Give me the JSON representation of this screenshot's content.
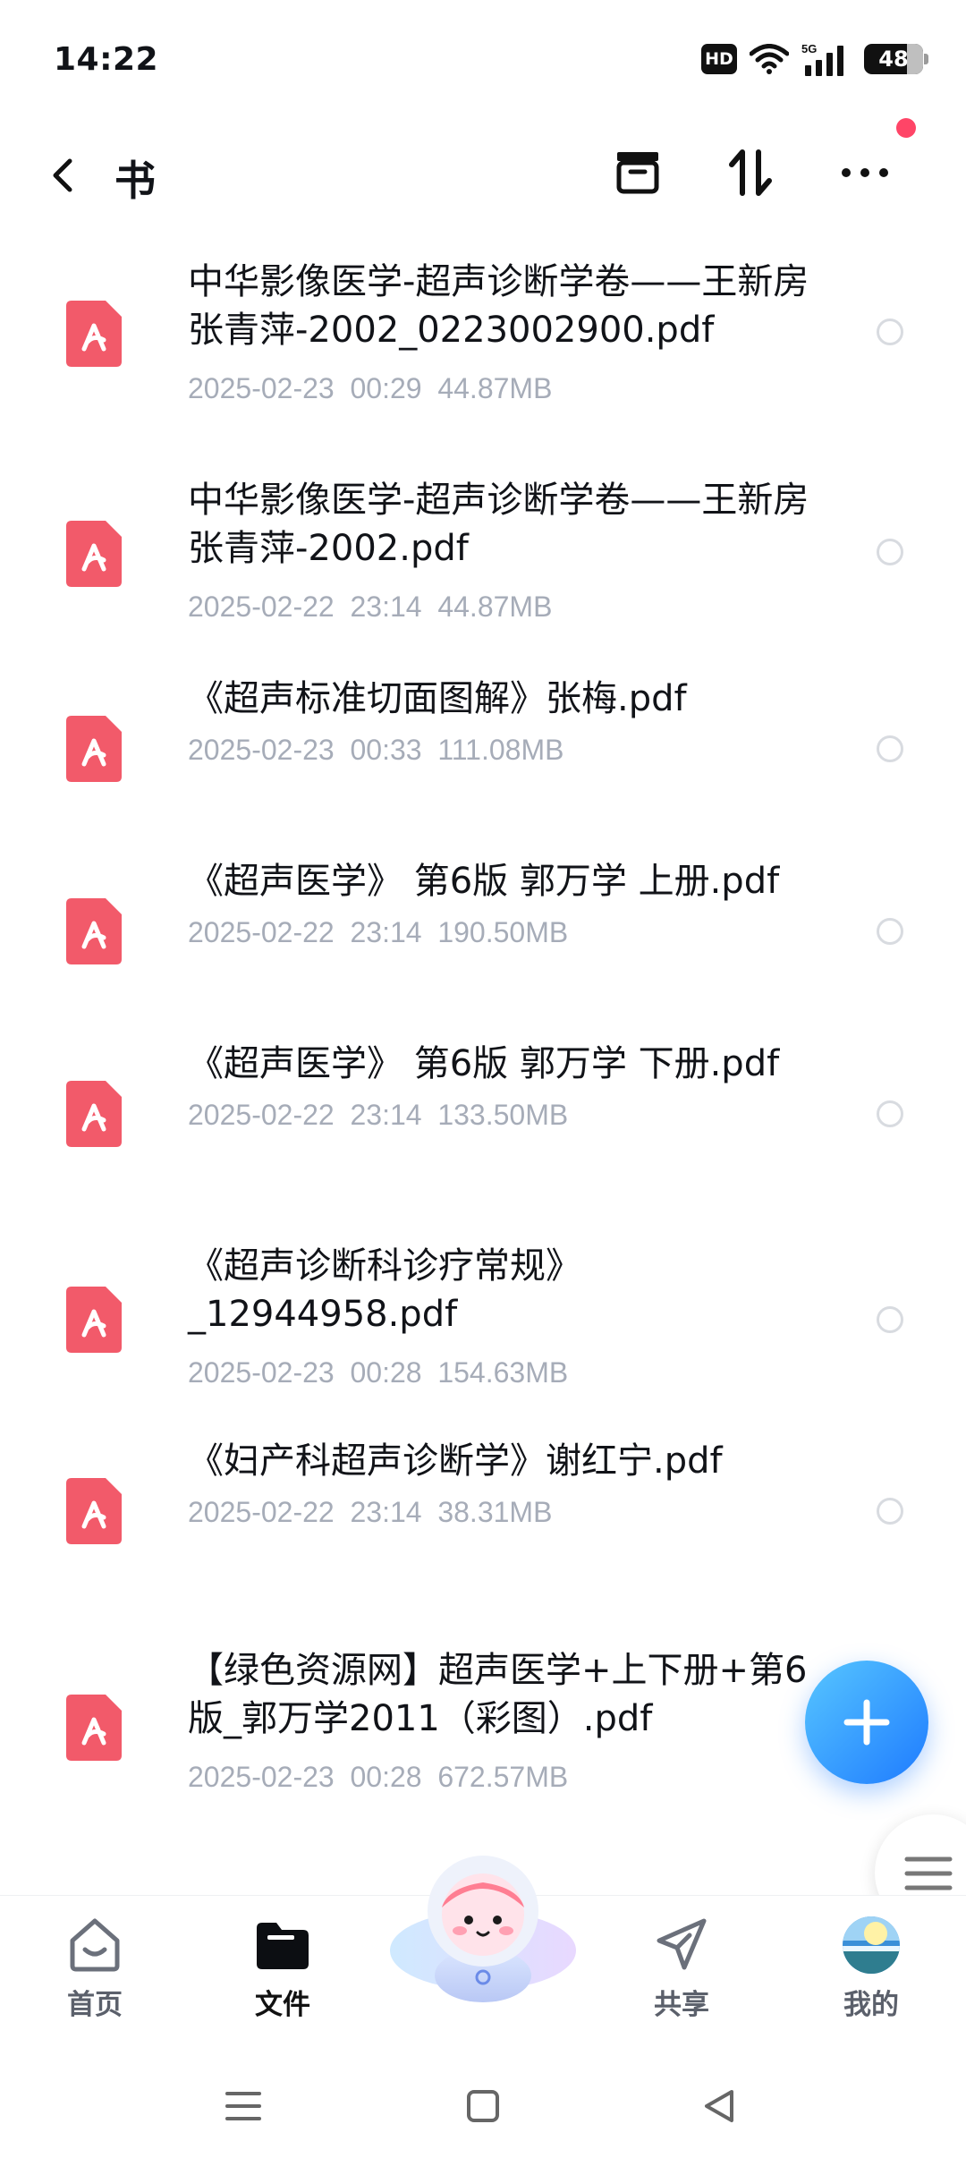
{
  "status_bar": {
    "time": "14:22",
    "hd": "HD",
    "network": "5G",
    "battery": "48"
  },
  "header": {
    "title": "书"
  },
  "files": [
    {
      "name": "中华影像医学-超声诊断学卷——王新房 张青萍-2002_0223002900.pdf",
      "meta": "2025-02-23  00:29  44.87MB"
    },
    {
      "name": "中华影像医学-超声诊断学卷——王新房 张青萍-2002.pdf",
      "meta": "2025-02-22  23:14  44.87MB"
    },
    {
      "name": "《超声标准切面图解》张梅.pdf",
      "meta": "2025-02-23  00:33  111.08MB"
    },
    {
      "name": "《超声医学》 第6版 郭万学 上册.pdf",
      "meta": "2025-02-22  23:14  190.50MB"
    },
    {
      "name": "《超声医学》 第6版 郭万学 下册.pdf",
      "meta": "2025-02-22  23:14  133.50MB"
    },
    {
      "name": "《超声诊断科诊疗常规》_12944958.pdf",
      "meta": "2025-02-23  00:28  154.63MB"
    },
    {
      "name": "《妇产科超声诊断学》谢红宁.pdf",
      "meta": "2025-02-22  23:14  38.31MB"
    },
    {
      "name": "【绿色资源网】超声医学+上下册+第6版_郭万学2011（彩图）.pdf",
      "meta": "2025-02-23  00:28  672.57MB"
    }
  ],
  "bottom_nav": {
    "home": "首页",
    "files": "文件",
    "share": "共享",
    "mine": "我的"
  },
  "colors": {
    "pdf_icon": "#f25a6a",
    "fab": "#2d8bff",
    "notification": "#ff4567",
    "meta_text": "#a6acb8"
  },
  "icons": [
    "back-icon",
    "archive-icon",
    "sort-icon",
    "more-icon",
    "pdf-icon",
    "plus-icon",
    "menu-icon",
    "home-icon",
    "folder-icon",
    "share-icon",
    "avatar-icon"
  ]
}
